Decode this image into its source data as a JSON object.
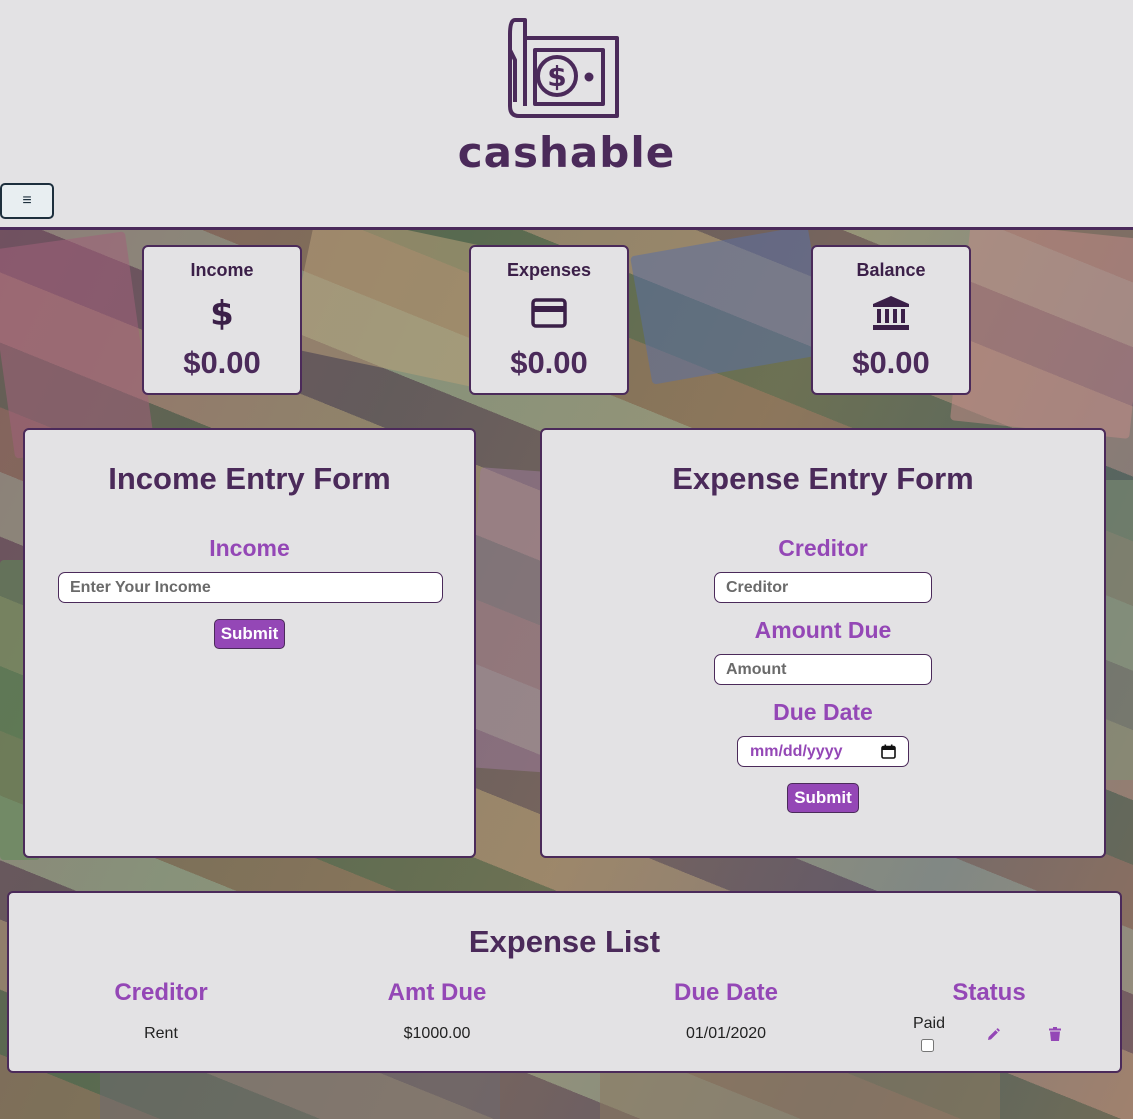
{
  "brand": {
    "name": "cashable",
    "logo_icon": "money-bill-hand-icon"
  },
  "menu": {
    "toggle_icon": "hamburger-icon",
    "glyph": "≡"
  },
  "colors": {
    "primary": "#4b2a5a",
    "accent": "#9447b6",
    "panel": "#e3e2e4"
  },
  "stats": [
    {
      "title": "Income",
      "icon": "dollar-icon",
      "value": "$0.00"
    },
    {
      "title": "Expenses",
      "icon": "credit-card-icon",
      "value": "$0.00"
    },
    {
      "title": "Balance",
      "icon": "bank-icon",
      "value": "$0.00"
    }
  ],
  "income_form": {
    "title": "Income Entry Form",
    "field_label": "Income",
    "placeholder": "Enter Your Income",
    "submit": "Submit"
  },
  "expense_form": {
    "title": "Expense Entry Form",
    "creditor_label": "Creditor",
    "creditor_placeholder": "Creditor",
    "amount_label": "Amount Due",
    "amount_placeholder": "Amount",
    "date_label": "Due Date",
    "date_placeholder": "mm/dd/yyyy",
    "submit": "Submit"
  },
  "expense_list": {
    "title": "Expense List",
    "columns": [
      "Creditor",
      "Amt Due",
      "Due Date",
      "Status"
    ],
    "rows": [
      {
        "creditor": "Rent",
        "amount": "$1000.00",
        "due_date": "01/01/2020",
        "status_label": "Paid",
        "paid": false,
        "edit_icon": "pencil-icon",
        "delete_icon": "trash-icon"
      }
    ]
  }
}
